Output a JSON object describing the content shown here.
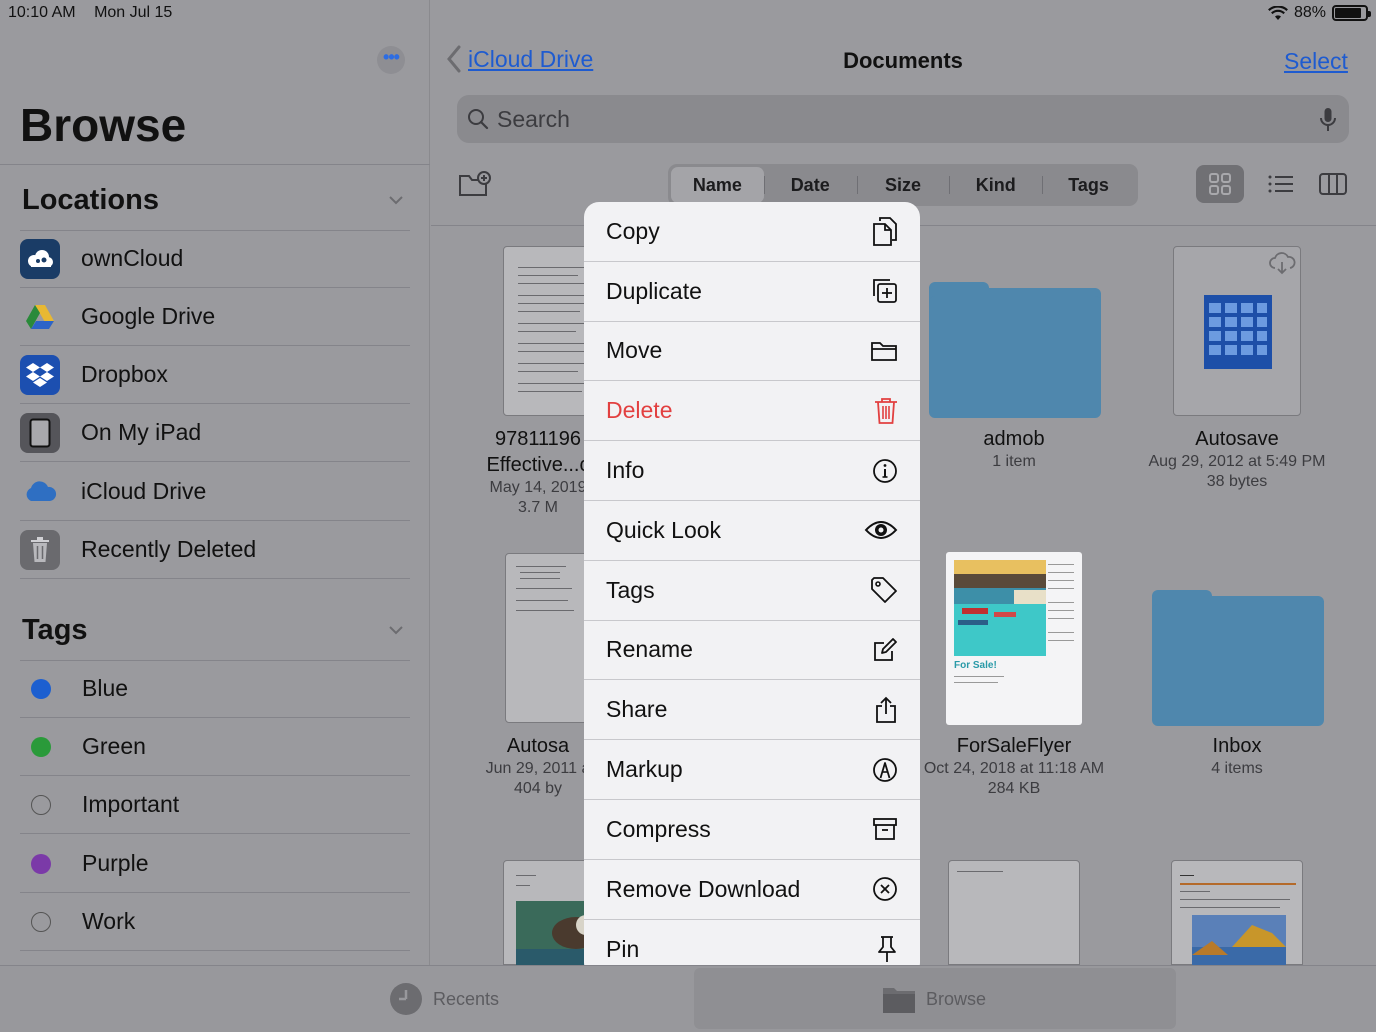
{
  "status": {
    "time": "10:10 AM",
    "date": "Mon Jul 15",
    "battery": "88%",
    "battery_level": 0.88
  },
  "sidebar": {
    "title": "Browse",
    "locations_header": "Locations",
    "locations": [
      {
        "label": "ownCloud",
        "icon": "owncloud-icon"
      },
      {
        "label": "Google Drive",
        "icon": "google-drive-icon"
      },
      {
        "label": "Dropbox",
        "icon": "dropbox-icon"
      },
      {
        "label": "On My iPad",
        "icon": "ipad-icon"
      },
      {
        "label": "iCloud Drive",
        "icon": "icloud-icon"
      },
      {
        "label": "Recently Deleted",
        "icon": "trash-icon"
      }
    ],
    "tags_header": "Tags",
    "tags": [
      {
        "label": "Blue",
        "color": "#1c5fd0"
      },
      {
        "label": "Green",
        "color": "#2a9a3a"
      },
      {
        "label": "Important",
        "color": ""
      },
      {
        "label": "Purple",
        "color": "#7b3aa8"
      },
      {
        "label": "Work",
        "color": ""
      }
    ]
  },
  "header": {
    "back_label": "iCloud Drive",
    "title": "Documents",
    "select_label": "Select",
    "search_placeholder": "Search"
  },
  "sort": {
    "options": [
      "Name",
      "Date",
      "Size",
      "Kind",
      "Tags"
    ],
    "active": "Name"
  },
  "files": [
    {
      "name1": "97811196",
      "name2": "Effective...c",
      "meta1": "May 14, 2019",
      "meta2": "3.7 M"
    },
    {
      "name1": "admob",
      "meta1": "1 item"
    },
    {
      "name1": "Autosave",
      "meta1": "Aug 29, 2012 at 5:49 PM",
      "meta2": "38 bytes"
    },
    {
      "name1": "Autosa",
      "meta1": "Jun 29, 2011 a",
      "meta2": "404 by"
    },
    {
      "name1": "ForSaleFlyer",
      "meta1": "Oct 24, 2018 at 11:18 AM",
      "meta2": "284 KB",
      "thumb_text": "For Sale!"
    },
    {
      "name1": "Inbox",
      "meta1": "4 items"
    }
  ],
  "menu": [
    {
      "label": "Copy",
      "icon": "copy-icon"
    },
    {
      "label": "Duplicate",
      "icon": "duplicate-icon"
    },
    {
      "label": "Move",
      "icon": "folder-icon"
    },
    {
      "label": "Delete",
      "icon": "trash-icon",
      "destructive": true
    },
    {
      "label": "Info",
      "icon": "info-icon"
    },
    {
      "label": "Quick Look",
      "icon": "eye-icon"
    },
    {
      "label": "Tags",
      "icon": "tag-icon"
    },
    {
      "label": "Rename",
      "icon": "pencil-square-icon"
    },
    {
      "label": "Share",
      "icon": "share-icon"
    },
    {
      "label": "Markup",
      "icon": "markup-icon"
    },
    {
      "label": "Compress",
      "icon": "archive-icon"
    },
    {
      "label": "Remove Download",
      "icon": "x-circle-icon"
    },
    {
      "label": "Pin",
      "icon": "pin-icon"
    }
  ],
  "tabbar": {
    "recents": "Recents",
    "browse": "Browse"
  },
  "colors": {
    "accent": "#1e5bd0",
    "destructive": "#e24040",
    "folder": "#4f87ad"
  }
}
